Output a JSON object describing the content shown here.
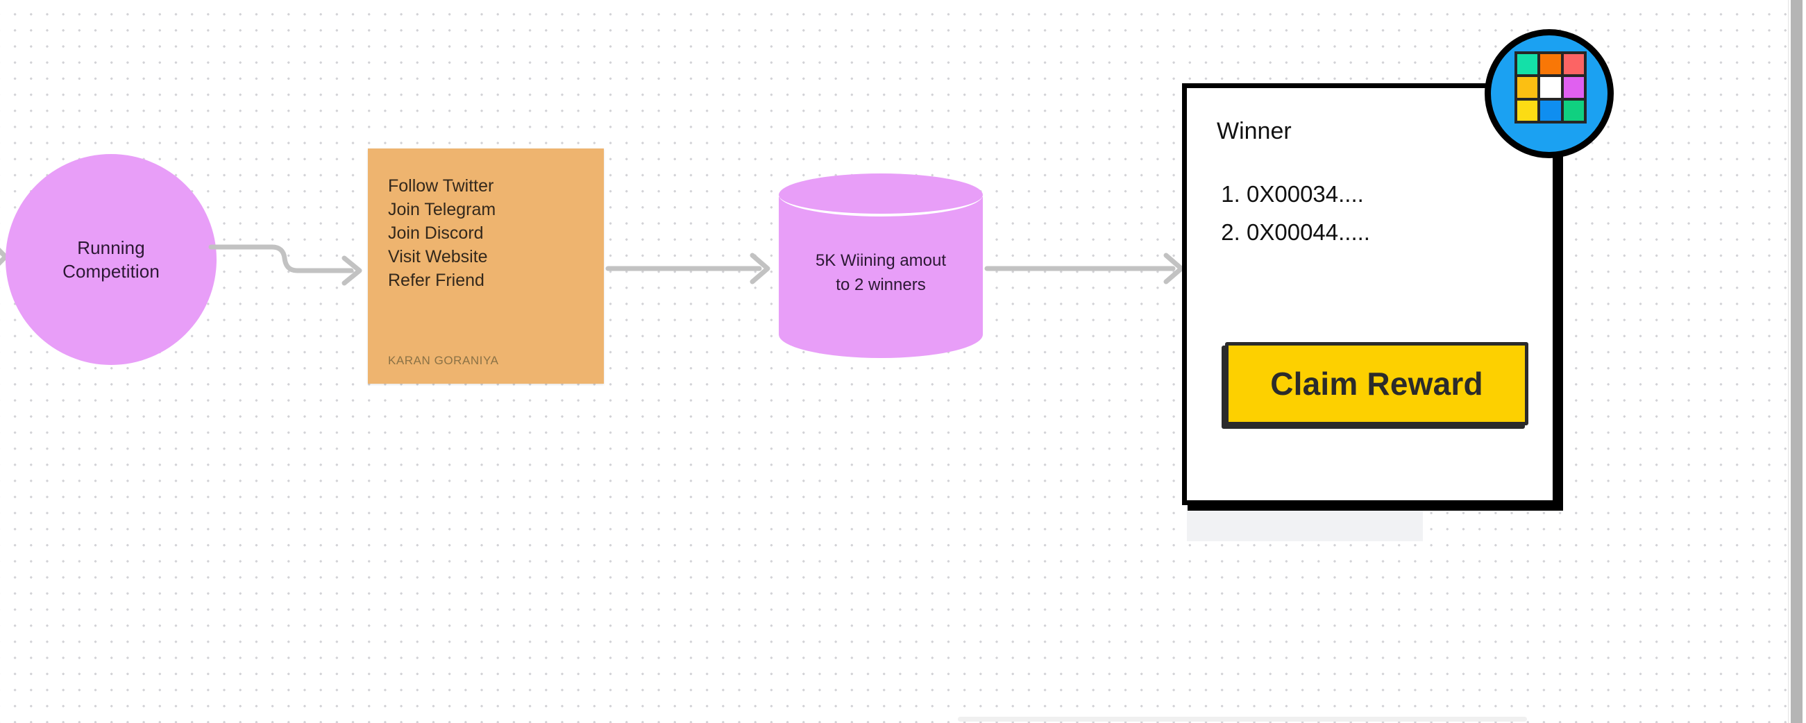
{
  "board": {
    "background_color": "#ffffff",
    "dot_color": "#d2d2d6"
  },
  "nodes": {
    "competition": {
      "name": "Running Competition",
      "line1": "Running",
      "line2": "Competition",
      "fill_color": "#e89ef8",
      "text_color": "#2b1833"
    },
    "tasks": {
      "fill_color": "#eeb46f",
      "items": [
        "Follow Twitter",
        "Join Telegram",
        "Join Discord",
        "Visit Website",
        "Refer Friend"
      ],
      "author": "KARAN GORANIYA",
      "author_color": "#8b7246"
    },
    "pool": {
      "line1": "5K Wiining amout",
      "line2": "to 2 winners",
      "fill_color": "#e89ef8",
      "text_color": "#2b1833"
    },
    "winner": {
      "title": "Winner",
      "addresses": [
        "0X00034....",
        "0X00044....."
      ],
      "border_color": "#000000",
      "panel_color": "#f1f2f4"
    }
  },
  "claim_button": {
    "label": "Claim Reward",
    "fill_color": "#fdd000",
    "border_color": "#2b2b2b",
    "text_color": "#2b2b2b"
  },
  "badge": {
    "icon_name": "color-grid-icon",
    "circle_color": "#1ba1f2",
    "ring_color": "#000000",
    "cells": [
      "#14e0a8",
      "#f97706",
      "#fc6464",
      "#fcbf12",
      "#ffffff",
      "#e060f0",
      "#fcdc14",
      "#0f8ef0",
      "#10d080"
    ]
  },
  "connectors": {
    "color": "#c2c2c2",
    "arrow_competition_to_tasks": "stepped",
    "arrow_tasks_to_pool": "straight",
    "arrow_pool_to_winner": "straight",
    "arrow_edge_left": "partial"
  },
  "scrollbars": {
    "vertical_thumb_color": "#b5b5b5",
    "horizontal_thumb_color": "#f0f0f0"
  }
}
